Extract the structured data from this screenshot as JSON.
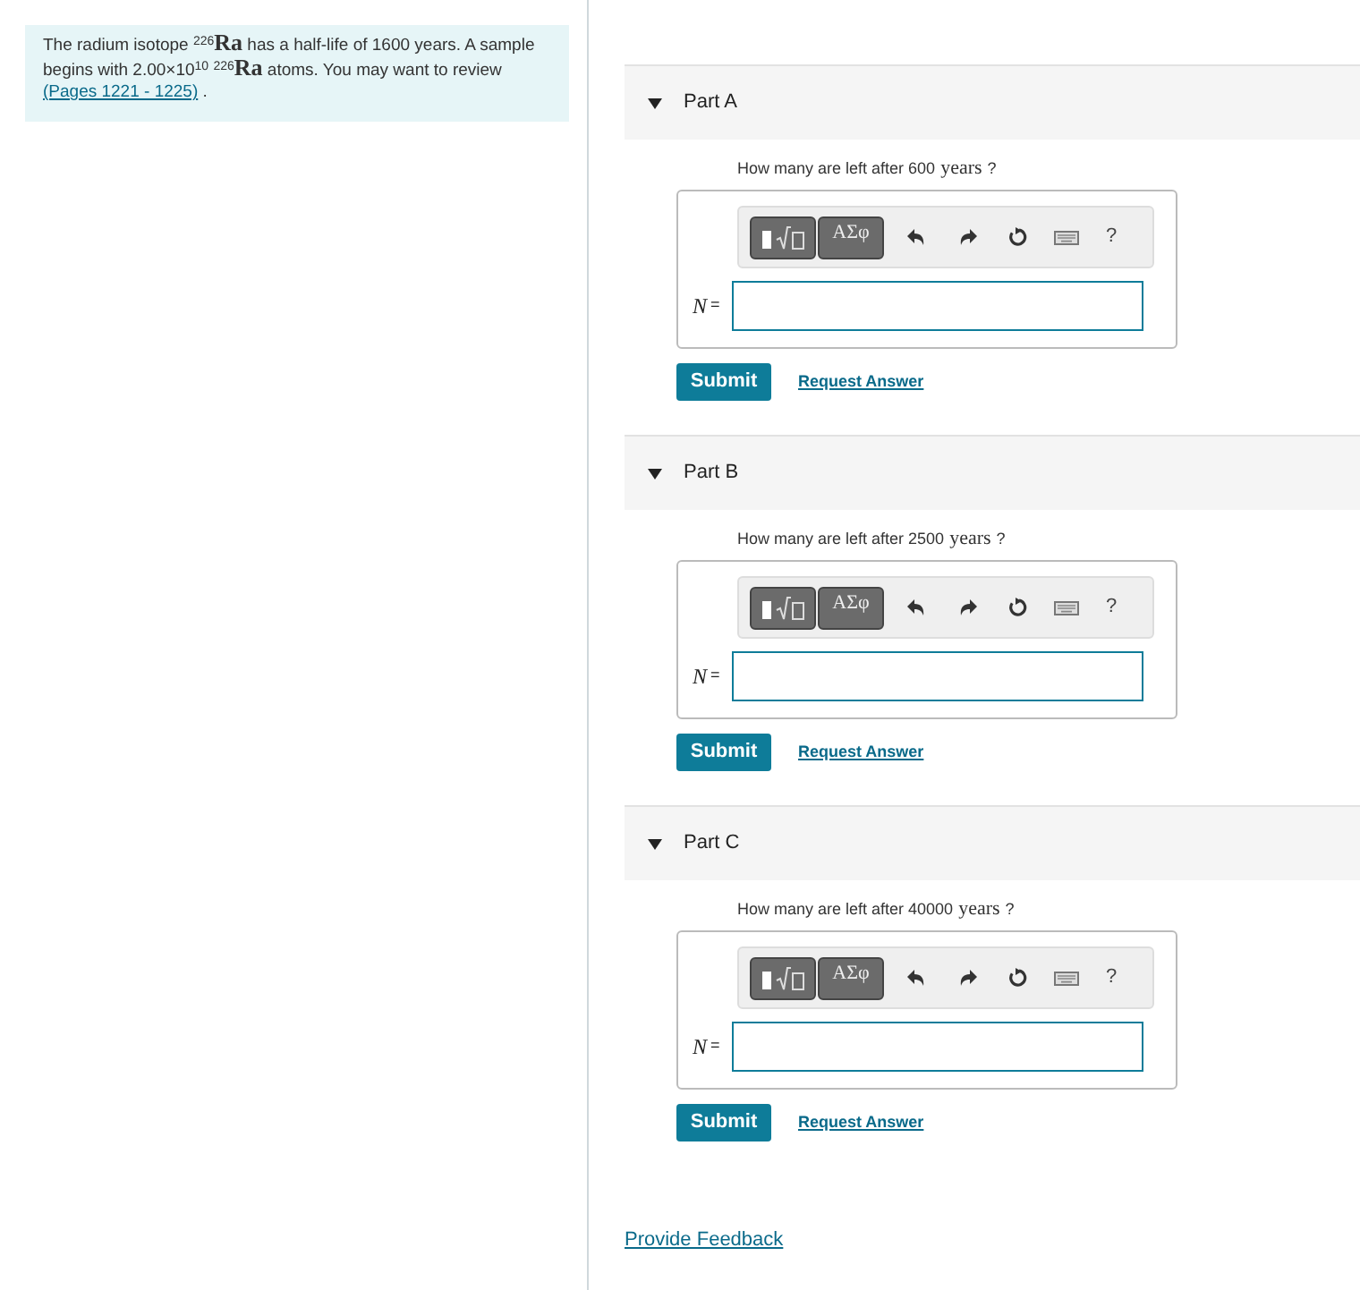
{
  "intro": {
    "text": "The radium isotope $^{226}$**Ra** has a half-life of 1600 years. A sample begins with 2.00×10$^{10}$ $^{226}$**Ra** atoms. You may want to review",
    "link": "(Pages 1221 - 1225)",
    "tail": " ."
  },
  "parts": [
    {
      "title": "Part A",
      "expanded": true,
      "question": "How many are left after 600",
      "unit": "years",
      "suffix": "?",
      "symbols_button": "ΑΣφ",
      "help": "?",
      "label": "N",
      "equals": "=",
      "submit": "Submit",
      "request": "Request Answer"
    },
    {
      "title": "Part B",
      "expanded": true,
      "question": "How many are left after 2500",
      "unit": "years",
      "suffix": "?",
      "symbols_button": "ΑΣφ",
      "help": "?",
      "label": "N",
      "equals": "=",
      "submit": "Submit",
      "request": "Request Answer"
    },
    {
      "title": "Part C",
      "expanded": true,
      "question": "How many are left after 40000",
      "unit": "years",
      "suffix": "?",
      "symbols_button": "ΑΣφ",
      "help": "?",
      "label": "N",
      "equals": "=",
      "submit": "Submit",
      "request": "Request Answer"
    }
  ],
  "feedback_link": "Provide Feedback"
}
